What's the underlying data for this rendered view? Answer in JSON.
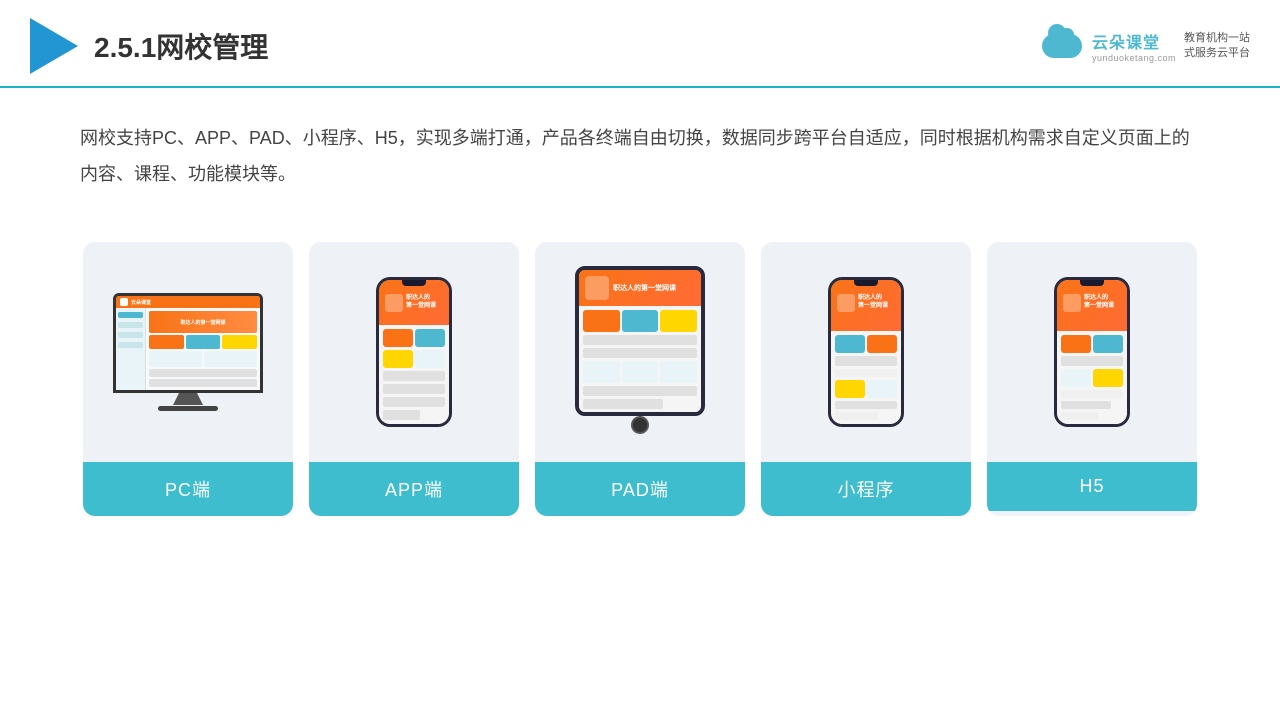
{
  "header": {
    "title": "2.5.1网校管理",
    "brand_name": "云朵课堂",
    "brand_url": "yunduoketang.com",
    "brand_slogan": "教育机构一站\n式服务云平台"
  },
  "description": {
    "text": "网校支持PC、APP、PAD、小程序、H5，实现多端打通，产品各终端自由切换，数据同步跨平台自适应，同时根据机构需求自定义页面上的内容、课程、功能模块等。"
  },
  "devices": [
    {
      "id": "pc",
      "label": "PC端"
    },
    {
      "id": "app",
      "label": "APP端"
    },
    {
      "id": "pad",
      "label": "PAD端"
    },
    {
      "id": "miniprogram",
      "label": "小程序"
    },
    {
      "id": "h5",
      "label": "H5"
    }
  ],
  "colors": {
    "accent": "#3dbdce",
    "accent_light": "#eef2f7",
    "header_border": "#1ab3c8",
    "triangle_blue": "#2196d3",
    "orange": "#f97316"
  }
}
